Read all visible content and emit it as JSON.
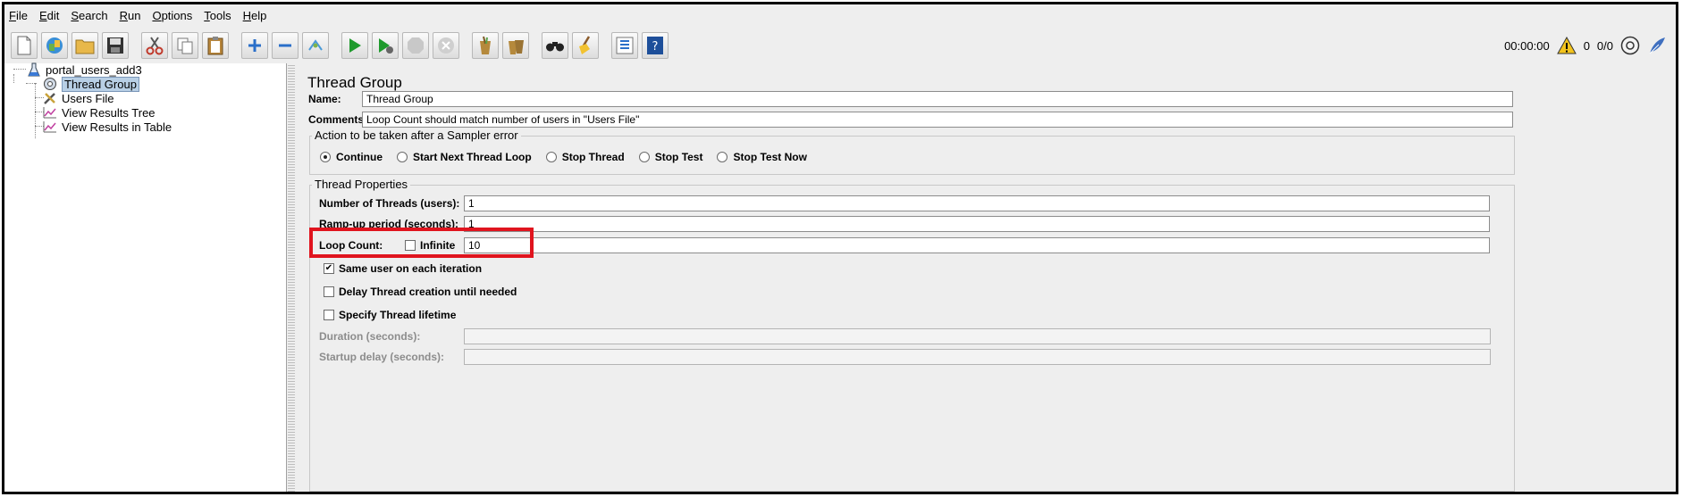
{
  "menu": {
    "items": [
      {
        "key": "F",
        "rest": "ile"
      },
      {
        "key": "E",
        "rest": "dit"
      },
      {
        "key": "S",
        "rest": "earch"
      },
      {
        "key": "R",
        "rest": "un"
      },
      {
        "key": "O",
        "rest": "ptions"
      },
      {
        "key": "T",
        "rest": "ools"
      },
      {
        "key": "H",
        "rest": "elp"
      }
    ]
  },
  "toolbar": {
    "icons": [
      "new-icon",
      "templates-icon",
      "open-icon",
      "save-icon",
      "cut-icon",
      "copy-icon",
      "paste-icon",
      "expand-icon",
      "collapse-icon",
      "toggle-icon",
      "start-icon",
      "start-no-pauses-icon",
      "stop-icon",
      "shutdown-icon",
      "clear-icon",
      "clear-all-icon",
      "search-icon",
      "reset-search-icon",
      "function-helper-icon",
      "help-icon"
    ],
    "timer": "00:00:00",
    "warning_count": "0",
    "threads": "0/0"
  },
  "tree": {
    "root": "portal_users_add3",
    "children": [
      "Thread Group",
      "Users File",
      "View Results Tree",
      "View Results in Table"
    ]
  },
  "panel": {
    "title": "Thread Group",
    "name_label": "Name:",
    "name_value": "Thread Group",
    "comments_label": "Comments:",
    "comments_value": "Loop Count should match number of users in \"Users File\"",
    "sampler_error": {
      "title": "Action to be taken after a Sampler error",
      "options": [
        "Continue",
        "Start Next Thread Loop",
        "Stop Thread",
        "Stop Test",
        "Stop Test Now"
      ],
      "selected": "Continue"
    },
    "thread_props": {
      "title": "Thread Properties",
      "threads_label": "Number of Threads (users):",
      "threads_value": "1",
      "rampup_label": "Ramp-up period (seconds):",
      "rampup_value": "1",
      "loop_label": "Loop Count:",
      "infinite_label": "Infinite",
      "loop_value": "10",
      "same_user_label": "Same user on each iteration",
      "same_user_checked": true,
      "delay_label": "Delay Thread creation until needed",
      "lifetime_label": "Specify Thread lifetime",
      "duration_label": "Duration (seconds):",
      "startup_label": "Startup delay (seconds):"
    }
  },
  "colors": {
    "highlight": "#e0141e",
    "selection": "#b8cfe5"
  }
}
